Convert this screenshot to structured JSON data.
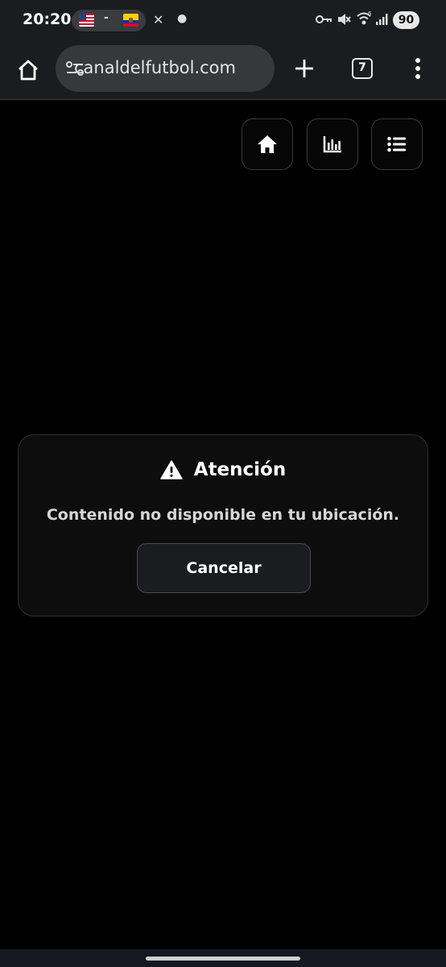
{
  "status_bar": {
    "time": "20:20",
    "vpn_separator": "-",
    "battery": "90",
    "icons": [
      "us-flag-icon",
      "ecuador-flag-icon",
      "x-icon",
      "dot-icon",
      "key-icon",
      "mute-icon",
      "wifi-icon",
      "signal-icon",
      "battery-icon"
    ]
  },
  "browser": {
    "url": "canaldelfutbol.com",
    "tab_count": "7",
    "icons": [
      "home-icon",
      "site-settings-icon",
      "plus-icon",
      "more-vert-icon"
    ]
  },
  "page_nav": {
    "icons": [
      "home-icon",
      "bar-chart-icon",
      "list-icon"
    ]
  },
  "modal": {
    "title": "Atención",
    "message": "Contenido no disponible en tu ubicación.",
    "cancel_label": "Cancelar",
    "icon": "warning-icon"
  },
  "colors": {
    "background": "#000000",
    "toolbar": "#1b1c1f",
    "omnibox": "#37383b",
    "modal_bg": "#0d0d0e",
    "button_bg": "#1b1c1f"
  }
}
